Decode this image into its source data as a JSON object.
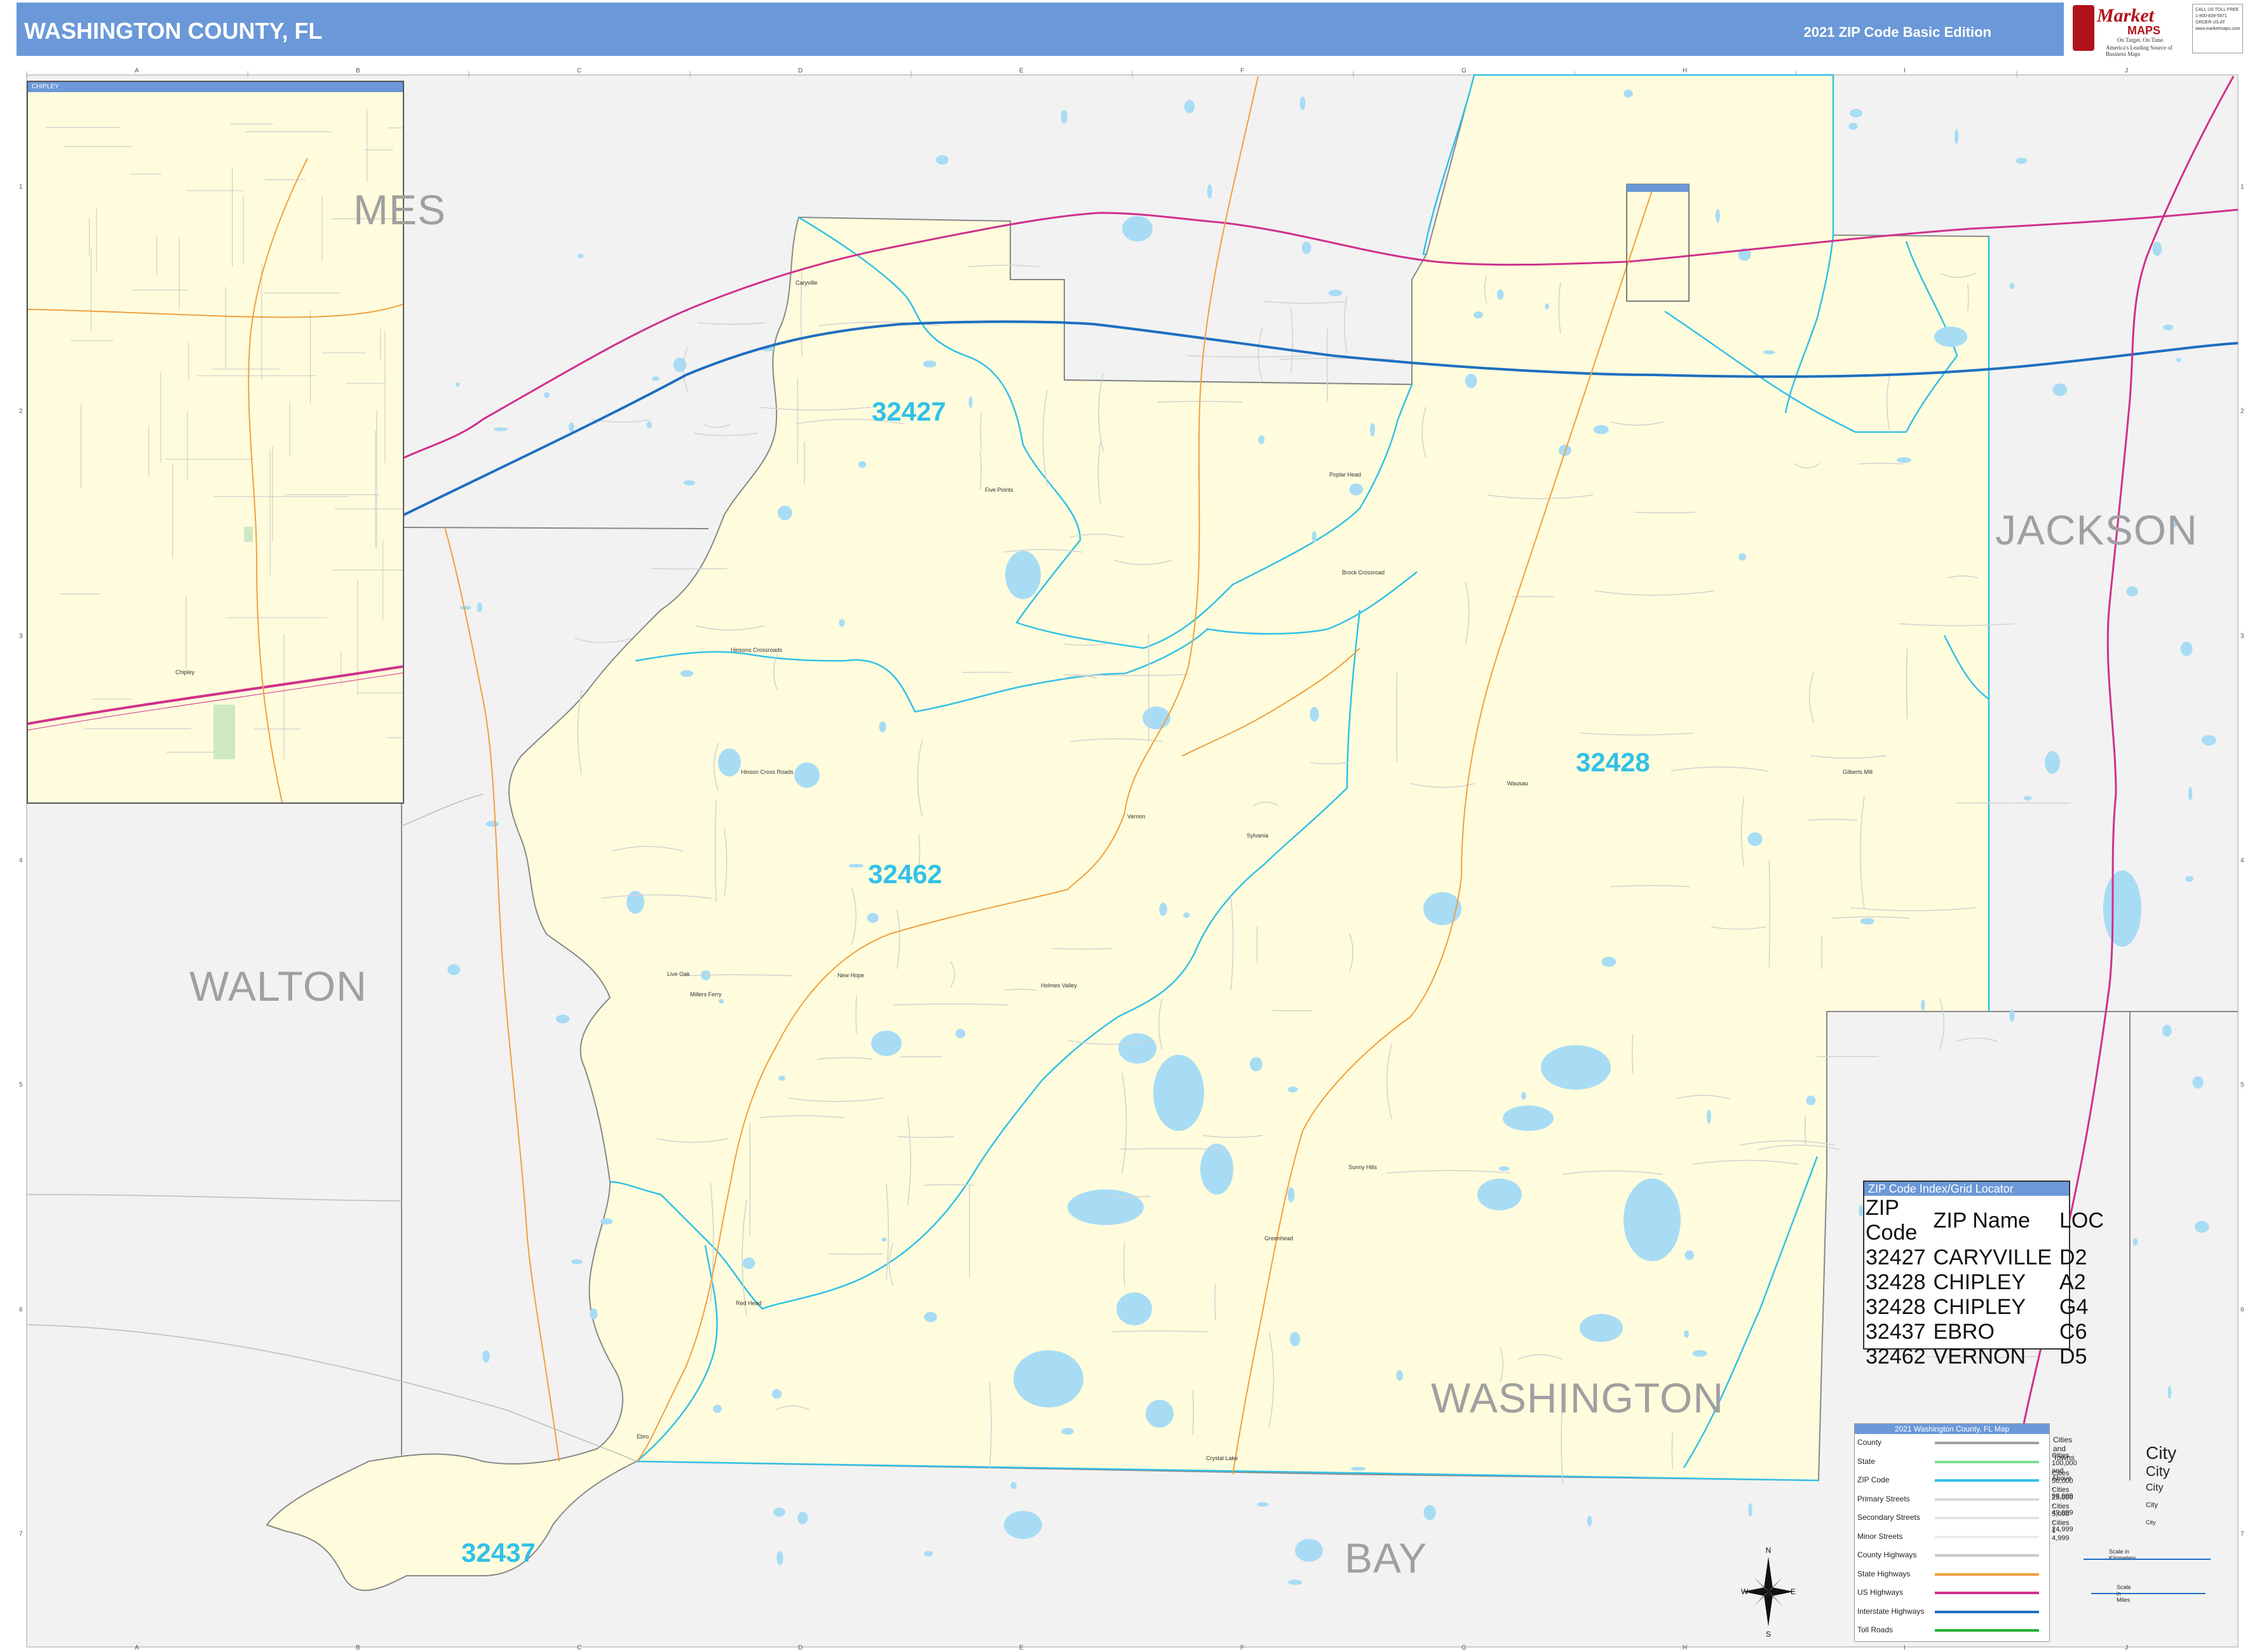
{
  "header": {
    "title": "WASHINGTON COUNTY, FL",
    "edition": "2021 ZIP Code Basic Edition"
  },
  "logo": {
    "brand_top": "Market",
    "brand_bottom": "MAPS",
    "tagline1": "On Target. On Time.",
    "tagline2": "America's Leading Source of Business Maps"
  },
  "call_box": [
    "CALL US TOLL FREE",
    "1-800-839-5971",
    "",
    "ORDER US AT",
    "www.marketmaps.com"
  ],
  "grid": {
    "columns": [
      "A",
      "B",
      "C",
      "D",
      "E",
      "F",
      "G",
      "H",
      "I",
      "J"
    ],
    "rows": [
      "1",
      "2",
      "3",
      "4",
      "5",
      "6",
      "7"
    ]
  },
  "inset": {
    "title": "CHIPLEY",
    "town": "Chipley"
  },
  "counties": {
    "holmes": "MES",
    "jackson": "JACKSON",
    "walton": "WALTON",
    "washington": "WASHINGTON",
    "bay": "BAY"
  },
  "zip_labels": {
    "z32427": "32427",
    "z32428": "32428",
    "z32462": "32462",
    "z32437": "32437"
  },
  "towns": {
    "caryville": "Caryville",
    "five_points": "Five Points",
    "poplar_head": "Poplar Head",
    "hinsons_crossroads": "Hinsons Crossroads",
    "hinson_cross_roads": "Hinson Cross Roads",
    "vernon": "Vernon",
    "sylvania": "Sylvania",
    "wausau": "Wausau",
    "gilberts_mill": "Gilberts Mill",
    "brock_crossroad": "Brock Crossroad",
    "live_oak": "Live Oak",
    "millers_ferry": "Millers Ferry",
    "new_hope": "New Hope",
    "holmes_valley": "Holmes Valley",
    "sunny_hills": "Sunny Hills",
    "greenhead": "Greenhead",
    "red_head": "Red Head",
    "ebro": "Ebro",
    "crystal_lake": "Crystal Lake"
  },
  "zip_index": {
    "title": "ZIP Code Index/Grid Locator",
    "columns": [
      "ZIP Code",
      "ZIP Name",
      "LOC"
    ],
    "rows": [
      [
        "32427",
        "CARYVILLE",
        "D2"
      ],
      [
        "32428",
        "CHIPLEY",
        "A2"
      ],
      [
        "32428",
        "CHIPLEY",
        "G4"
      ],
      [
        "32437",
        "EBRO",
        "C6"
      ],
      [
        "32462",
        "VERNON",
        "D5"
      ]
    ]
  },
  "legend": {
    "title": "2021 Washington County, FL Map",
    "items": [
      {
        "label": "County",
        "color": "#a0a0a0"
      },
      {
        "label": "State",
        "color": "#7be08f"
      },
      {
        "label": "ZIP Code",
        "color": "#33c0e8"
      },
      {
        "label": "Primary Streets",
        "color": "#d8d8d8"
      },
      {
        "label": "Secondary Streets",
        "color": "#e2e2e2"
      },
      {
        "label": "Minor Streets",
        "color": "#ececec"
      },
      {
        "label": "County Highways",
        "color": "#c8c8c8"
      },
      {
        "label": "State Highways",
        "color": "#f0a040"
      },
      {
        "label": "US Highways",
        "color": "#d0308c"
      },
      {
        "label": "Interstate Highways",
        "color": "#1e6fc0"
      },
      {
        "label": "Toll Roads",
        "color": "#22b030"
      }
    ],
    "cities_heading": "Cities and Towns",
    "cities": [
      {
        "label": "Cities 100,000 and Above",
        "sample": "City"
      },
      {
        "label": "Cities 50,000 - 99,999",
        "sample": "City"
      },
      {
        "label": "Cities 25,000 - 49,999",
        "sample": "City"
      },
      {
        "label": "Cities 5,000 - 24,999",
        "sample": "City"
      },
      {
        "label": "Cities 1 - 4,999",
        "sample": "City"
      }
    ],
    "scale_km": "Scale in Kilometers",
    "scale_mi": "Scale in Miles"
  },
  "compass": {
    "n": "N",
    "s": "S",
    "e": "E",
    "w": "W"
  },
  "colors": {
    "header": "#6b98d8",
    "county_fill": "#fefcdc",
    "outside": "#f2f2f2",
    "water": "#a8dcf5",
    "zip_line": "#33c0e8",
    "interstate": "#1e6fc0",
    "us_highway": "#d0308c",
    "state_highway": "#f0a040"
  }
}
